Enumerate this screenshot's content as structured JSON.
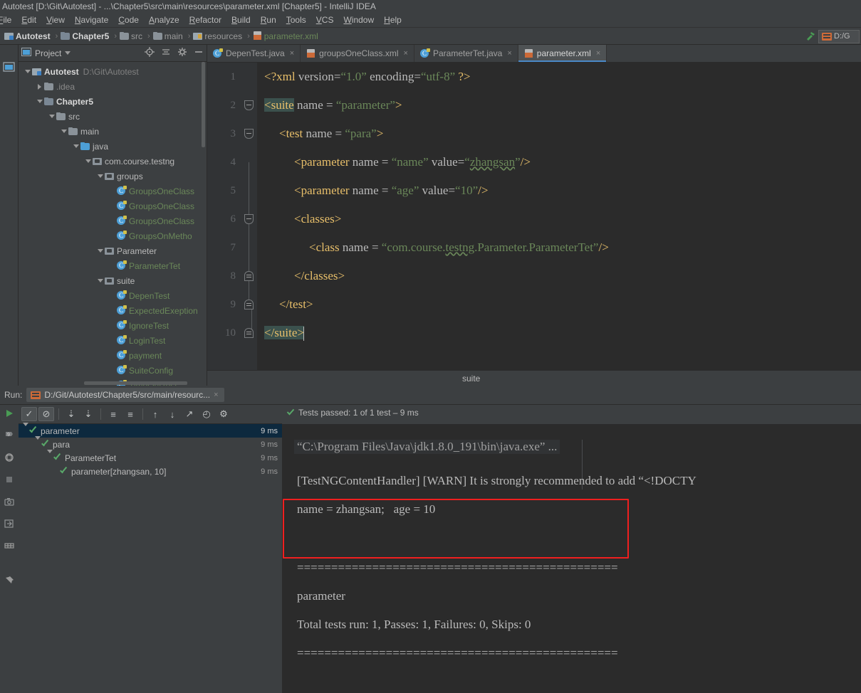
{
  "window": {
    "title": "Autotest [D:\\Git\\Autotest] - ...\\Chapter5\\src\\main\\resources\\parameter.xml [Chapter5] - IntelliJ IDEA"
  },
  "menubar": {
    "items": [
      "File",
      "Edit",
      "View",
      "Navigate",
      "Code",
      "Analyze",
      "Refactor",
      "Build",
      "Run",
      "Tools",
      "VCS",
      "Window",
      "Help"
    ]
  },
  "breadcrumb": {
    "items": [
      {
        "label": "Autotest",
        "icon": "project-icon",
        "style": "bold"
      },
      {
        "label": "Chapter5",
        "icon": "module-icon",
        "style": "bold"
      },
      {
        "label": "src",
        "icon": "folder-icon",
        "style": "dim"
      },
      {
        "label": "main",
        "icon": "folder-icon",
        "style": "dim"
      },
      {
        "label": "resources",
        "icon": "resources-folder-icon",
        "style": "dim"
      },
      {
        "label": "parameter.xml",
        "icon": "xml-file-icon",
        "style": "xmlfile"
      }
    ],
    "separator": "›"
  },
  "navbar_right": {
    "build_icon": "hammer-icon",
    "run_config": "D:/G",
    "run_config_icon": "testng-icon"
  },
  "project_panel": {
    "title": "Project",
    "dropdown_icon": "chevron-down-icon",
    "actions": [
      {
        "name": "locate-icon"
      },
      {
        "name": "collapse-all-icon"
      },
      {
        "name": "gear-icon"
      },
      {
        "name": "hide-icon"
      }
    ],
    "tree": [
      {
        "depth": 0,
        "arrow": "down",
        "icon": "project-icon",
        "label": "Autotest",
        "bold": true,
        "sub": "D:\\Git\\Autotest"
      },
      {
        "depth": 1,
        "arrow": "right",
        "icon": "folder-icon",
        "label": ".idea",
        "dim": true
      },
      {
        "depth": 1,
        "arrow": "down",
        "icon": "module-icon",
        "label": "Chapter5",
        "bold": true
      },
      {
        "depth": 2,
        "arrow": "down",
        "icon": "src-folder-icon",
        "label": "src"
      },
      {
        "depth": 3,
        "arrow": "down",
        "icon": "folder-icon",
        "label": "main"
      },
      {
        "depth": 4,
        "arrow": "down",
        "icon": "java-folder-icon",
        "label": "java"
      },
      {
        "depth": 5,
        "arrow": "down",
        "icon": "package-icon",
        "label": "com.course.testng"
      },
      {
        "depth": 6,
        "arrow": "down",
        "icon": "package-icon",
        "label": "groups"
      },
      {
        "depth": 7,
        "arrow": "none",
        "icon": "java-class-icon",
        "label": "GroupsOneClass",
        "green": true
      },
      {
        "depth": 7,
        "arrow": "none",
        "icon": "java-class-icon",
        "label": "GroupsOneClass",
        "green": true
      },
      {
        "depth": 7,
        "arrow": "none",
        "icon": "java-class-icon",
        "label": "GroupsOneClass",
        "green": true
      },
      {
        "depth": 7,
        "arrow": "none",
        "icon": "java-class-icon",
        "label": "GroupsOnMetho",
        "green": true
      },
      {
        "depth": 6,
        "arrow": "down",
        "icon": "package-icon",
        "label": "Parameter"
      },
      {
        "depth": 7,
        "arrow": "none",
        "icon": "java-class-icon",
        "label": "ParameterTet",
        "green": true
      },
      {
        "depth": 6,
        "arrow": "down",
        "icon": "package-icon",
        "label": "suite"
      },
      {
        "depth": 7,
        "arrow": "none",
        "icon": "java-class-icon",
        "label": "DepenTest",
        "green": true
      },
      {
        "depth": 7,
        "arrow": "none",
        "icon": "java-class-icon",
        "label": "ExpectedExeption",
        "green": true
      },
      {
        "depth": 7,
        "arrow": "none",
        "icon": "java-class-icon",
        "label": "IgnoreTest",
        "green": true
      },
      {
        "depth": 7,
        "arrow": "none",
        "icon": "java-class-icon",
        "label": "LoginTest",
        "green": true
      },
      {
        "depth": 7,
        "arrow": "none",
        "icon": "java-class-icon",
        "label": "payment",
        "green": true
      },
      {
        "depth": 7,
        "arrow": "none",
        "icon": "java-class-icon",
        "label": "SuiteConfig",
        "green": true
      },
      {
        "depth": 7,
        "arrow": "none",
        "icon": "java-class-icon",
        "label": "TimeOutTest",
        "green": true
      }
    ]
  },
  "editor": {
    "tabs": [
      {
        "label": "DepenTest.java",
        "icon": "java-class-icon",
        "active": false,
        "close": "×"
      },
      {
        "label": "groupsOneClass.xml",
        "icon": "xml-file-icon",
        "active": false,
        "close": "×"
      },
      {
        "label": "ParameterTet.java",
        "icon": "java-class-icon",
        "active": false,
        "close": "×"
      },
      {
        "label": "parameter.xml",
        "icon": "xml-file-icon",
        "active": true,
        "close": "×"
      }
    ],
    "line_numbers": [
      "1",
      "2",
      "3",
      "4",
      "5",
      "6",
      "7",
      "8",
      "9",
      "10"
    ],
    "lines": [
      {
        "n": 1,
        "indent": 0,
        "tokens": [
          {
            "t": "<?xml",
            "c": "t-decl"
          },
          {
            "t": " version=",
            "c": "t-attr"
          },
          {
            "t": "“1.0”",
            "c": "t-val"
          },
          {
            "t": " encoding=",
            "c": "t-attr"
          },
          {
            "t": "“utf-8”",
            "c": "t-val"
          },
          {
            "t": " ?>",
            "c": "t-decl"
          }
        ]
      },
      {
        "n": 2,
        "indent": 0,
        "tokens": [
          {
            "t": "<suite",
            "c": "t-tag hl-match"
          },
          {
            "t": " name = ",
            "c": "t-attr"
          },
          {
            "t": "“parameter”",
            "c": "t-val"
          },
          {
            "t": ">",
            "c": "t-tag"
          }
        ]
      },
      {
        "n": 3,
        "indent": 1,
        "tokens": [
          {
            "t": "<test",
            "c": "t-tag"
          },
          {
            "t": " name = ",
            "c": "t-attr"
          },
          {
            "t": "“para”",
            "c": "t-val"
          },
          {
            "t": ">",
            "c": "t-tag"
          }
        ]
      },
      {
        "n": 4,
        "indent": 2,
        "tokens": [
          {
            "t": "<parameter",
            "c": "t-tag"
          },
          {
            "t": " name = ",
            "c": "t-attr"
          },
          {
            "t": "“name”",
            "c": "t-val"
          },
          {
            "t": " value=",
            "c": "t-attr"
          },
          {
            "t": "“",
            "c": "t-val"
          },
          {
            "t": "zhangsan",
            "c": "t-val squiggle"
          },
          {
            "t": "”",
            "c": "t-val"
          },
          {
            "t": "/>",
            "c": "t-tag"
          }
        ]
      },
      {
        "n": 5,
        "indent": 2,
        "tokens": [
          {
            "t": "<parameter",
            "c": "t-tag"
          },
          {
            "t": " name = ",
            "c": "t-attr"
          },
          {
            "t": "“age”",
            "c": "t-val"
          },
          {
            "t": " value=",
            "c": "t-attr"
          },
          {
            "t": "“10”",
            "c": "t-val"
          },
          {
            "t": "/>",
            "c": "t-tag"
          }
        ]
      },
      {
        "n": 6,
        "indent": 2,
        "tokens": [
          {
            "t": "<classes>",
            "c": "t-tag"
          }
        ]
      },
      {
        "n": 7,
        "indent": 3,
        "tokens": [
          {
            "t": "<class",
            "c": "t-tag"
          },
          {
            "t": " name = ",
            "c": "t-attr"
          },
          {
            "t": "“com.course.",
            "c": "t-val"
          },
          {
            "t": "testng",
            "c": "t-val squiggle"
          },
          {
            "t": ".Parameter.ParameterTet”",
            "c": "t-val"
          },
          {
            "t": "/>",
            "c": "t-tag"
          }
        ]
      },
      {
        "n": 8,
        "indent": 2,
        "tokens": [
          {
            "t": "</classes>",
            "c": "t-tag"
          }
        ]
      },
      {
        "n": 9,
        "indent": 1,
        "tokens": [
          {
            "t": "</test>",
            "c": "t-tag"
          }
        ]
      },
      {
        "n": 10,
        "indent": 0,
        "tokens": [
          {
            "t": "</suite>",
            "c": "t-tag hl-match"
          }
        ]
      }
    ],
    "breadcrumb_bottom": "suite"
  },
  "run_panel": {
    "label": "Run:",
    "tab_title": "D:/Git/Autotest/Chapter5/src/main/resourc...",
    "tab_close": "×",
    "tab_icon": "testng-icon",
    "side_buttons": [
      {
        "name": "rerun-icon"
      },
      {
        "name": "rerun-failed-icon"
      },
      {
        "name": "toggle-auto-test-icon"
      },
      {
        "name": "stop-icon"
      },
      {
        "name": "screenshot-icon"
      },
      {
        "name": "export-icon"
      },
      {
        "name": "layout-icon"
      },
      {
        "name": "pin-icon"
      }
    ],
    "toolbar": [
      {
        "name": "show-passed-toggle",
        "glyph": "✓",
        "active": true
      },
      {
        "name": "show-ignored-toggle",
        "glyph": "⊘",
        "active": true
      },
      {
        "name": "sort-alphabetically-icon",
        "glyph": "⇣"
      },
      {
        "name": "sort-by-duration-icon",
        "glyph": "⇣"
      },
      {
        "name": "expand-all-icon",
        "glyph": "≡"
      },
      {
        "name": "collapse-all-icon",
        "glyph": "≡"
      },
      {
        "name": "prev-failed-icon",
        "glyph": "↑"
      },
      {
        "name": "next-failed-icon",
        "glyph": "↓"
      },
      {
        "name": "export-test-results-icon",
        "glyph": "↗"
      },
      {
        "name": "test-history-icon",
        "glyph": "◴"
      },
      {
        "name": "settings-gear-icon",
        "glyph": "⚙"
      }
    ],
    "status": "Tests passed: 1 of 1 test – 9 ms",
    "status_icon": "check-icon",
    "tree": [
      {
        "depth": 0,
        "arrow": "down",
        "label": "parameter",
        "duration": "9 ms",
        "selected": true
      },
      {
        "depth": 1,
        "arrow": "down",
        "label": "para",
        "duration": "9 ms",
        "selected": false
      },
      {
        "depth": 2,
        "arrow": "down",
        "label": "ParameterTet",
        "duration": "9 ms",
        "selected": false
      },
      {
        "depth": 3,
        "arrow": "none",
        "label": "parameter[zhangsan, 10]",
        "duration": "9 ms",
        "selected": false
      }
    ],
    "console_lines": [
      {
        "text": "“C:\\Program Files\\Java\\jdk1.8.0_191\\bin\\java.exe” ...",
        "kind": "cmd"
      },
      {
        "text": "[TestNGContentHandler] [WARN] It is strongly recommended to add “<!DOCTY",
        "kind": "out"
      },
      {
        "text": "name = zhangsan;   age = 10",
        "kind": "out",
        "highlighted": true
      },
      {
        "text": "===============================================",
        "kind": "out"
      },
      {
        "text": "parameter",
        "kind": "out"
      },
      {
        "text": "Total tests run: 1, Passes: 1, Failures: 0, Skips: 0",
        "kind": "out"
      },
      {
        "text": "===============================================",
        "kind": "out"
      }
    ],
    "highlight_color": "#f01f1f"
  }
}
